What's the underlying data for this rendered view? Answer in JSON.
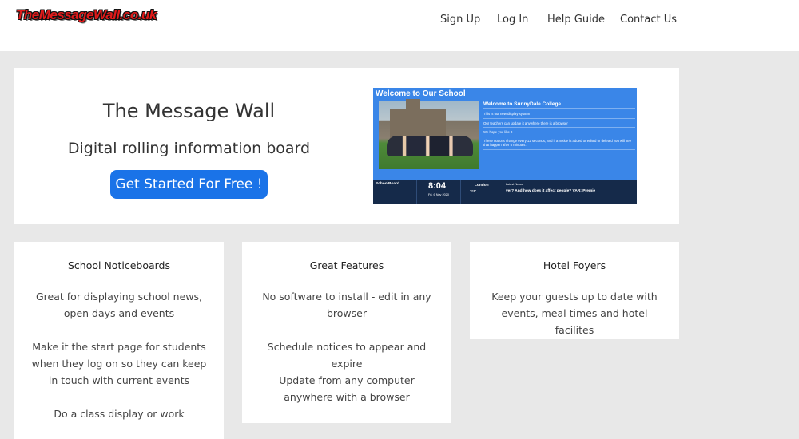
{
  "header": {
    "logo_text": "TheMessageWall.co.uk",
    "nav": [
      "Sign Up",
      "Log In",
      "Help Guide",
      "Contact Us"
    ]
  },
  "hero": {
    "title": "The Message Wall",
    "subtitle": "Digital rolling information board",
    "cta_label": "Get Started For Free !",
    "preview": {
      "heading": "Welcome to Our School",
      "notice_title": "Welcome to SunnyDale College",
      "notice_lines": [
        "This is our new display system",
        "Our teachers can update it anywhere there is a browser",
        "We hope you like it",
        "These notices change every 12 seconds, and if a notice is added or edited or deleted you will see that happen after 5 minutes."
      ],
      "bar": {
        "brand": "SchoolBoard",
        "time": "8:04",
        "date": "Fri, 6 Nov 2020",
        "city": "London",
        "temp": "3°C",
        "news_label": "Latest News",
        "news_text": "ver? And how does it affect people?  VAR: Premie"
      }
    }
  },
  "cards": [
    {
      "title": "School Noticeboards",
      "paragraphs": [
        "Great for displaying school news, open days and events",
        "Make it the start page for students when they log on so they can keep in touch with current events",
        "Do a class display or work"
      ]
    },
    {
      "title": "Great Features",
      "paragraphs": [
        "No software to install - edit in any browser",
        "Schedule notices to appear and expire",
        "Update from any computer anywhere with a browser"
      ]
    },
    {
      "title": "Hotel Foyers",
      "paragraphs": [
        "Keep your guests up to date with events, meal times and hotel facilites"
      ]
    }
  ]
}
